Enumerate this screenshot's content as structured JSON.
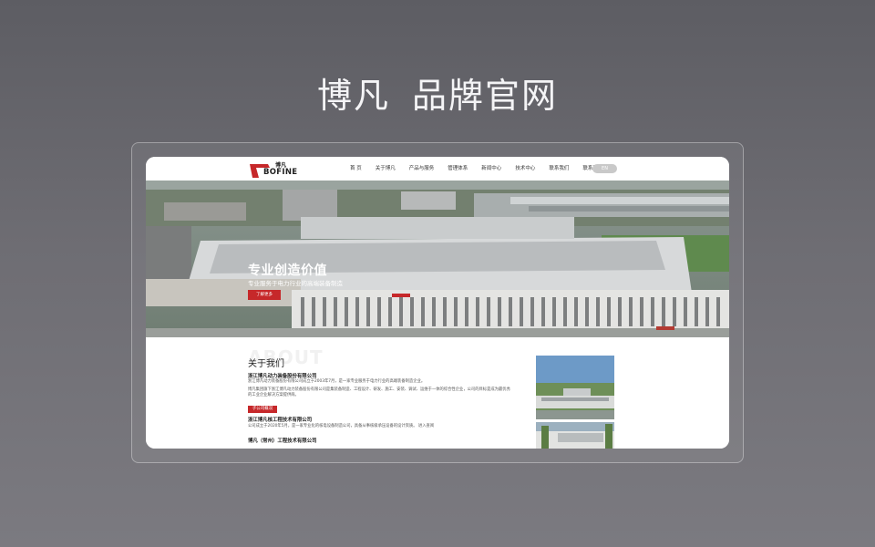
{
  "headline": {
    "brand": "博凡",
    "subtitle": "品牌官网"
  },
  "site": {
    "logo": {
      "cn": "博凡",
      "en": "BOFINE"
    },
    "nav": [
      "首 页",
      "关于博凡",
      "产品与服务",
      "管理体系",
      "新闻中心",
      "技术中心",
      "联系我们",
      "联系我们"
    ],
    "lang": "EN",
    "hero": {
      "title": "专业创造价值",
      "subtitle": "专业服务于电力行业的高端装备制造",
      "button": "了解更多"
    },
    "about": {
      "ghost": "ABOUT",
      "title": "关于我们",
      "company1": "浙江博凡动力装备股份有限公司",
      "text1": "浙江博凡动力装备股份有限公司成立于2003年7月，是一家专业服务于电力行业的高端装备制造企业。",
      "text2": "博凡集团旗下浙江博凡动力装备股份有限公司是集装备制造、工程设计、研发、施工、安装、调试、运维于一体的综合性企业，公司的目标是成为最优秀的工业企业解决方案提供商。",
      "subsidiary_tag": "子公司概况",
      "company2": "浙江博凡核工程技术有限公司",
      "text3": "公司成立于2020年5月，是一家专业化的核电设备制造公司，具备从事核级承压设备的设计资质。 进入查阅",
      "more": "进入查阅",
      "company3": "博凡（常州）工程技术有限公司"
    }
  },
  "colors": {
    "accent": "#c6282a"
  }
}
